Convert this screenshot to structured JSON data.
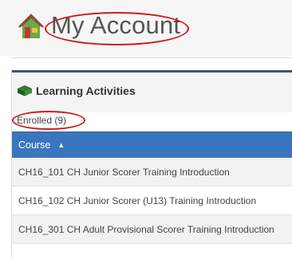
{
  "header": {
    "title": "My Account",
    "app_icon": "house-icon"
  },
  "learning": {
    "title": "Learning Activities",
    "icon": "book-icon",
    "tab_enrolled": "Enrolled (9)"
  },
  "table": {
    "column_course": "Course",
    "sort_glyph": "▲",
    "rows": [
      {
        "course": "CH16_101 CH Junior Scorer Training Introduction"
      },
      {
        "course": "CH16_102 CH Junior Scorer (U13) Training Introduction"
      },
      {
        "course": "CH16_301 CH Adult Provisional Scorer Training Introduction"
      }
    ]
  },
  "colors": {
    "header_bar": "#3a76bd",
    "annotation": "#d0191c",
    "panel_top_border": "#3c5570"
  }
}
